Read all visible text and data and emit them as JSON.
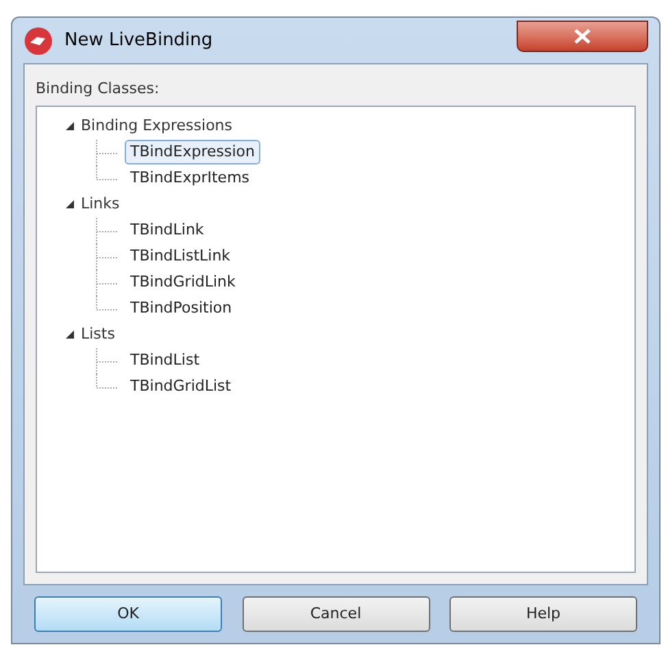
{
  "window": {
    "title": "New LiveBinding"
  },
  "label": "Binding Classes:",
  "tree": [
    {
      "label": "Binding Expressions",
      "expanded": true,
      "children": [
        {
          "label": "TBindExpression",
          "selected": true
        },
        {
          "label": "TBindExprItems",
          "selected": false
        }
      ]
    },
    {
      "label": "Links",
      "expanded": true,
      "children": [
        {
          "label": "TBindLink",
          "selected": false
        },
        {
          "label": "TBindListLink",
          "selected": false
        },
        {
          "label": "TBindGridLink",
          "selected": false
        },
        {
          "label": "TBindPosition",
          "selected": false
        }
      ]
    },
    {
      "label": "Lists",
      "expanded": true,
      "children": [
        {
          "label": "TBindList",
          "selected": false
        },
        {
          "label": "TBindGridList",
          "selected": false
        }
      ]
    }
  ],
  "buttons": [
    {
      "label": "OK",
      "default": true
    },
    {
      "label": "Cancel",
      "default": false
    },
    {
      "label": "Help",
      "default": false
    }
  ]
}
